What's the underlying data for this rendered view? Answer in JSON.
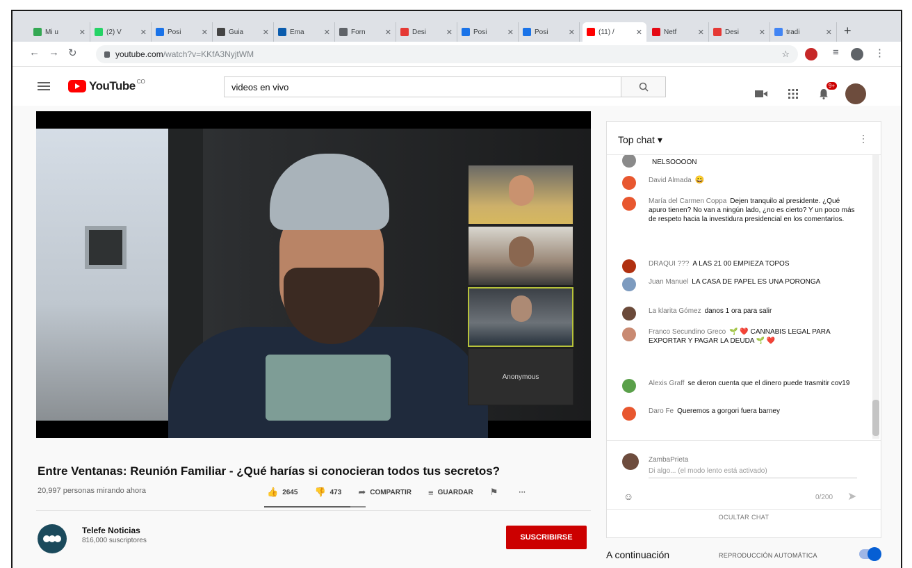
{
  "browser": {
    "tabs": [
      {
        "title": "Mi u",
        "color": "#34a853"
      },
      {
        "title": "(2) V",
        "color": "#25d366"
      },
      {
        "title": "Posi",
        "color": "#1a73e8"
      },
      {
        "title": "Guia",
        "color": "#444444"
      },
      {
        "title": "Ema",
        "color": "#0b5cad"
      },
      {
        "title": "Forn",
        "color": "#5f6368"
      },
      {
        "title": "Desi",
        "color": "#e53935"
      },
      {
        "title": "Posi",
        "color": "#1a73e8"
      },
      {
        "title": "Posi",
        "color": "#1a73e8"
      },
      {
        "title": "(11) /",
        "color": "#ff0000"
      },
      {
        "title": "Netf",
        "color": "#e50914"
      },
      {
        "title": "Desi",
        "color": "#e53935"
      },
      {
        "title": "tradi",
        "color": "#4285f4"
      }
    ],
    "new_tab": "+",
    "url_host": "youtube.com",
    "url_path": "/watch?v=KKfA3NyjtWM"
  },
  "youtube": {
    "logo": "YouTube",
    "logo_suffix": "CO",
    "search_value": "videos en vivo",
    "notif_count": "9+"
  },
  "video": {
    "title": "Entre Ventanas: Reunión Familiar - ¿Qué harías si conocieran todos tus secretos?",
    "viewers": "20,997 personas mirando ahora",
    "likes": "2645",
    "dislikes": "473",
    "share_label": "COMPARTIR",
    "save_label": "GUARDAR",
    "more": "···",
    "participant_label": "Anonymous",
    "like_ratio": 0.85
  },
  "channel": {
    "name": "Telefe Noticias",
    "subscribers": "816,000 suscriptores",
    "subscribe_label": "SUSCRIBIRSE"
  },
  "chat": {
    "header": "Top chat",
    "messages": [
      {
        "author": "",
        "text": "NELSOOOON",
        "color": "#8a8a8a"
      },
      {
        "author": "David Almada",
        "text": "😀",
        "color": "#e8572f"
      },
      {
        "author": "María del Carmen Coppa",
        "text": "Dejen tranquilo al presidente. ¿Qué apuro tienen? No van a ningún lado, ¿no es cierto? Y un poco más de respeto hacia la investidura presidencial en los comentarios.",
        "color": "#e8572f"
      },
      {
        "author": "DRAQUI ???",
        "text": "A LAS 21 00 EMPIEZA TOPOS",
        "color": "#b03010"
      },
      {
        "author": "Juan Manuel",
        "text": "LA CASA DE PAPEL ES UNA PORONGA",
        "color": "#7d9bbf"
      },
      {
        "author": "La klarita Gómez",
        "text": "danos 1 ora para salir",
        "color": "#6b4a3a"
      },
      {
        "author": "Franco Secundino Greco",
        "text": "🌱 ❤️ CANNABIS LEGAL PARA EXPORTAR Y PAGAR LA DEUDA 🌱 ❤️",
        "color": "#c98a72"
      },
      {
        "author": "Alexis Graff",
        "text": "se dieron cuenta que el dinero puede trasmitir cov19",
        "color": "#5aa04a"
      },
      {
        "author": "Daro Fe",
        "text": "Queremos a gorgori fuera barney",
        "color": "#e8572f"
      }
    ],
    "composer_user": "ZambaPrieta",
    "composer_placeholder": "Di algo... (el modo lento está activado)",
    "char_count": "0/200",
    "hide_label": "OCULTAR CHAT"
  },
  "up_next": {
    "label": "A continuación",
    "autoplay_label": "REPRODUCCIÓN AUTOMÁTICA",
    "autoplay_on": true
  }
}
